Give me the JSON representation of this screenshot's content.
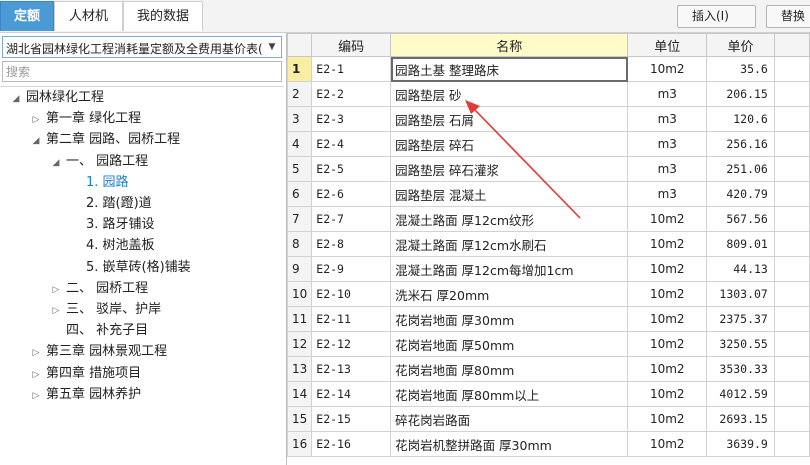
{
  "tabs": [
    {
      "label": "定额",
      "active": true
    },
    {
      "label": "人材机",
      "active": false
    },
    {
      "label": "我的数据",
      "active": false
    }
  ],
  "toolbar": {
    "insert_label": "插入(I)",
    "replace_label": "替换"
  },
  "left": {
    "library_select": "湖北省园林绿化工程消耗量定额及全费用基价表(",
    "search_placeholder": "搜索"
  },
  "tree": [
    {
      "label": "园林绿化工程",
      "expanded": true,
      "level": 0
    },
    {
      "label": "第一章  绿化工程",
      "expanded": false,
      "level": 1
    },
    {
      "label": "第二章  园路、园桥工程",
      "expanded": true,
      "level": 1
    },
    {
      "label": "一、  园路工程",
      "expanded": true,
      "level": 2
    },
    {
      "label": "1.  园路",
      "level": 3,
      "selected": true
    },
    {
      "label": "2.  踏(蹬)道",
      "level": 3
    },
    {
      "label": "3.  路牙铺设",
      "level": 3
    },
    {
      "label": "4.  树池盖板",
      "level": 3
    },
    {
      "label": "5.  嵌草砖(格)铺装",
      "level": 3
    },
    {
      "label": "二、  园桥工程",
      "expanded": false,
      "level": 2
    },
    {
      "label": "三、  驳岸、护岸",
      "expanded": false,
      "level": 2
    },
    {
      "label": "四、  补充子目",
      "level": 2
    },
    {
      "label": "第三章  园林景观工程",
      "expanded": false,
      "level": 1
    },
    {
      "label": "第四章  措施项目",
      "expanded": false,
      "level": 1
    },
    {
      "label": "第五章  园林养护",
      "expanded": false,
      "level": 1
    }
  ],
  "grid": {
    "headers": [
      "编码",
      "名称",
      "单位",
      "单价"
    ],
    "rows": [
      [
        "1",
        "E2-1",
        "园路土基  整理路床",
        "10m2",
        "35.6"
      ],
      [
        "2",
        "E2-2",
        "园路垫层  砂",
        "m3",
        "206.15"
      ],
      [
        "3",
        "E2-3",
        "园路垫层  石屑",
        "m3",
        "120.6"
      ],
      [
        "4",
        "E2-4",
        "园路垫层  碎石",
        "m3",
        "256.16"
      ],
      [
        "5",
        "E2-5",
        "园路垫层  碎石灌浆",
        "m3",
        "251.06"
      ],
      [
        "6",
        "E2-6",
        "园路垫层  混凝土",
        "m3",
        "420.79"
      ],
      [
        "7",
        "E2-7",
        "混凝土路面  厚12cm纹形",
        "10m2",
        "567.56"
      ],
      [
        "8",
        "E2-8",
        "混凝土路面  厚12cm水刷石",
        "10m2",
        "809.01"
      ],
      [
        "9",
        "E2-9",
        "混凝土路面  厚12cm每增加1cm",
        "10m2",
        "44.13"
      ],
      [
        "10",
        "E2-10",
        "洗米石  厚20mm",
        "10m2",
        "1303.07"
      ],
      [
        "11",
        "E2-11",
        "花岗岩地面  厚30mm",
        "10m2",
        "2375.37"
      ],
      [
        "12",
        "E2-12",
        "花岗岩地面  厚50mm",
        "10m2",
        "3250.55"
      ],
      [
        "13",
        "E2-13",
        "花岗岩地面  厚80mm",
        "10m2",
        "3530.33"
      ],
      [
        "14",
        "E2-14",
        "花岗岩地面  厚80mm以上",
        "10m2",
        "4012.59"
      ],
      [
        "15",
        "E2-15",
        "碎花岗岩路面",
        "10m2",
        "2693.15"
      ],
      [
        "16",
        "E2-16",
        "花岗岩机整拼路面  厚30mm",
        "10m2",
        "3639.9"
      ]
    ]
  },
  "colors": {
    "accent": "#4a9ad6",
    "selected_text": "#1e7fd1",
    "header_highlight": "#fffbc8",
    "annotation_arrow": "#e53935"
  }
}
